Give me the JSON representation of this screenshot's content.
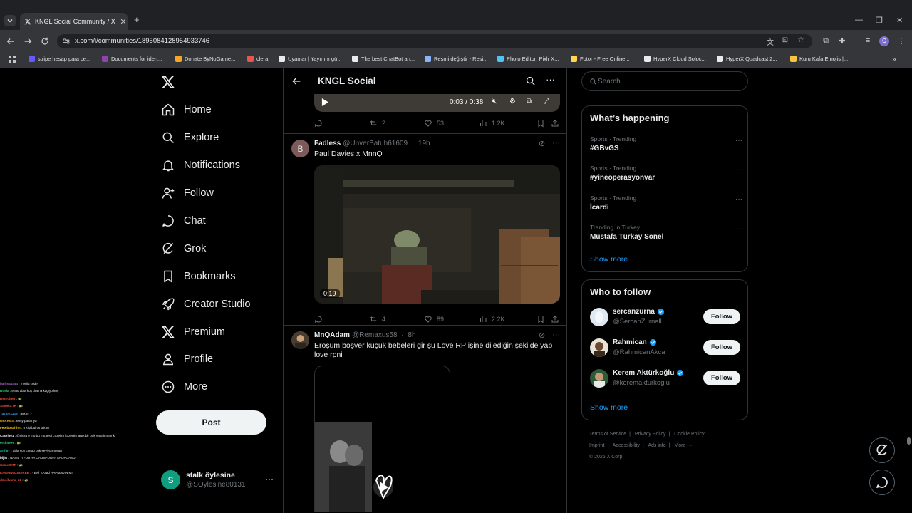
{
  "browser": {
    "tab_title": "KNGL Social Community / X",
    "url": "x.com/i/communities/1895084128954933746",
    "bookmarks": [
      {
        "label": "stripe hesap para ce...",
        "color": "#635bff"
      },
      {
        "label": "Documents for iden...",
        "color": "#8e44ad"
      },
      {
        "label": "Donate ByNoGame...",
        "color": "#f5a623"
      },
      {
        "label": "clera",
        "color": "#e8554e"
      },
      {
        "label": "Uyanlar | Yayınını gü...",
        "color": "#e8eaed"
      },
      {
        "label": "The best ChatBot an...",
        "color": "#e8eaed"
      },
      {
        "label": "Resmi değiştir - Resi...",
        "color": "#8ab4f8"
      },
      {
        "label": "Photo Editor: Pixlr X...",
        "color": "#4fc3f7"
      },
      {
        "label": "Fotor - Free Online...",
        "color": "#ffd54f"
      },
      {
        "label": "HyperX Cloud Soloc...",
        "color": "#e8eaed"
      },
      {
        "label": "HyperX Quadcast 2...",
        "color": "#e8eaed"
      },
      {
        "label": "Kuru Kafa Emojis |...",
        "color": "#f6c445"
      }
    ]
  },
  "nav": {
    "items": [
      {
        "label": "Home",
        "icon": "home-icon"
      },
      {
        "label": "Explore",
        "icon": "search-icon"
      },
      {
        "label": "Notifications",
        "icon": "bell-icon"
      },
      {
        "label": "Follow",
        "icon": "person-add-icon"
      },
      {
        "label": "Chat",
        "icon": "chat-icon"
      },
      {
        "label": "Grok",
        "icon": "grok-icon"
      },
      {
        "label": "Bookmarks",
        "icon": "bookmark-icon"
      },
      {
        "label": "Creator Studio",
        "icon": "rocket-icon"
      },
      {
        "label": "Premium",
        "icon": "x-icon"
      },
      {
        "label": "Profile",
        "icon": "person-icon"
      },
      {
        "label": "More",
        "icon": "more-circle-icon"
      }
    ],
    "post_label": "Post",
    "account": {
      "initial": "S",
      "name": "stalk öylesine",
      "handle": "@SOylesine80131"
    }
  },
  "chat_overlay": [
    {
      "user": "bariis44444",
      "msg": "media code",
      "color": "#9b59b6"
    },
    {
      "user": "Rosia",
      "msg": "ennu abla koş drama kaçıyo koş",
      "color": "#2ecc71"
    },
    {
      "user": "Recruiner",
      "msg": "🐢",
      "color": "#e74c3c"
    },
    {
      "user": "SametXTR",
      "msg": "🐢",
      "color": "#e74c3c"
    },
    {
      "user": "Taylon1219",
      "msg": "aşkım ?",
      "color": "#3498db"
    },
    {
      "user": "DEKKES",
      "msg": "ensy patlar ya",
      "color": "#f39c12"
    },
    {
      "user": "Feteboaahhh",
      "msg": "5 kişi bul cs takım",
      "color": "#f1c40f"
    },
    {
      "user": "Cagri991",
      "msg": "@clera o mu bu mu testi çözelim kuzenim artık bir bok yapalım amk",
      "color": "#ecf0f1"
    },
    {
      "user": "erclineee",
      "msg": "🐢",
      "color": "#2ecc71"
    },
    {
      "user": "artff67",
      "msg": "abla son cılego cok seviyormusun",
      "color": "#1abc9c"
    },
    {
      "user": "bijlN",
      "msg": "NASIL YIYOR YA OAUSPDOHYSAOPOASU",
      "color": "#ecf0f1"
    },
    {
      "user": "SametXTR",
      "msg": "🐢",
      "color": "#e74c3c"
    },
    {
      "user": "KNGFINOZEIEKEE",
      "msg": "YENİ KANKİ YAPMADIN MI",
      "color": "#e74c3c"
    },
    {
      "user": "dmsilvana_22",
      "msg": "🐢",
      "color": "#e74c3c"
    }
  ],
  "community": {
    "title": "KNGL Social"
  },
  "top_video": {
    "time": "0:03 / 0:38",
    "stats": {
      "replies": "",
      "reposts": "2",
      "likes": "53",
      "views": "1.2K"
    }
  },
  "posts": [
    {
      "name": "Fadless",
      "handle": "@UnverBatuh61609",
      "time": "19h",
      "avatar_initial": "B",
      "text": "Paul Davies x MnnQ",
      "video_duration": "0:19",
      "stats": {
        "replies": "",
        "reposts": "4",
        "likes": "89",
        "views": "2.2K"
      }
    },
    {
      "name": "MnQAdam",
      "handle": "@Remaxus58",
      "time": "8h",
      "text": "Eroşum boşver küçük bebeleri gir şu Love RP işine dilediğin şekilde yap love rpni"
    }
  ],
  "sidebar": {
    "search_placeholder": "Search",
    "happening_title": "What’s happening",
    "trends": [
      {
        "category": "Sports · Trending",
        "title": "#GBvGS"
      },
      {
        "category": "Sports · Trending",
        "title": "#yineoperasyonvar"
      },
      {
        "category": "Sports · Trending",
        "title": "İcardi"
      },
      {
        "category": "Trending in Turkey",
        "title": "Mustafa Türkay Sonel"
      }
    ],
    "show_more": "Show more",
    "who_to_follow_title": "Who to follow",
    "follow_suggestions": [
      {
        "name": "sercanzurna",
        "handle": "@SercanZurnall",
        "verified": true,
        "button": "Follow"
      },
      {
        "name": "Rahmican",
        "handle": "@RahmicanAkca",
        "verified": true,
        "button": "Follow"
      },
      {
        "name": "Kerem Aktürkoğlu",
        "handle": "@keremakturkoglu",
        "verified": true,
        "button": "Follow"
      }
    ],
    "footer": [
      "Terms of Service",
      "|",
      "Privacy Policy",
      "|",
      "Cookie Policy",
      "|",
      "Imprint",
      "|",
      "Accessibility",
      "|",
      "Ads info",
      "|",
      "More ···",
      "© 2026 X Corp."
    ]
  },
  "colors": {
    "accent": "#1d9bf0",
    "verified": "#1d9bf0",
    "border": "#2f3336",
    "muted": "#71767b"
  }
}
